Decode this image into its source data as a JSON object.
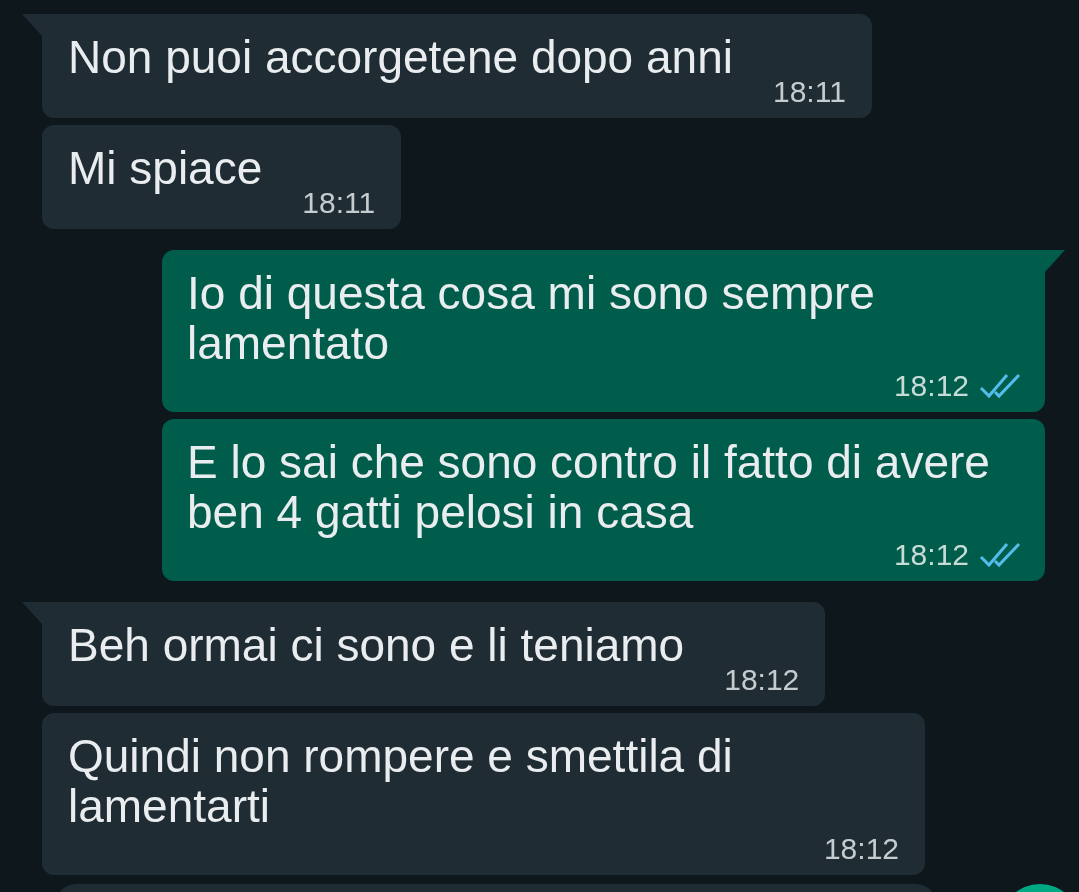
{
  "messages": [
    {
      "kind": "received",
      "tail": true,
      "text": "Non puoi accorgetene dopo anni",
      "time": "18:11"
    },
    {
      "kind": "received",
      "tail": false,
      "text": "Mi spiace",
      "time": "18:11"
    },
    {
      "kind": "sent",
      "tail": true,
      "text": "Io di questa cosa mi sono sempre lamentato",
      "time": "18:12",
      "read": true
    },
    {
      "kind": "sent",
      "tail": false,
      "text": "E lo sai che sono contro il fatto di avere ben 4 gatti pelosi in casa",
      "time": "18:12",
      "read": true
    },
    {
      "kind": "received",
      "tail": true,
      "text": "Beh ormai ci sono e li teniamo",
      "time": "18:12"
    },
    {
      "kind": "received",
      "tail": false,
      "text": "Quindi non rompere e smettila di lamentarti",
      "time": "18:12"
    }
  ]
}
